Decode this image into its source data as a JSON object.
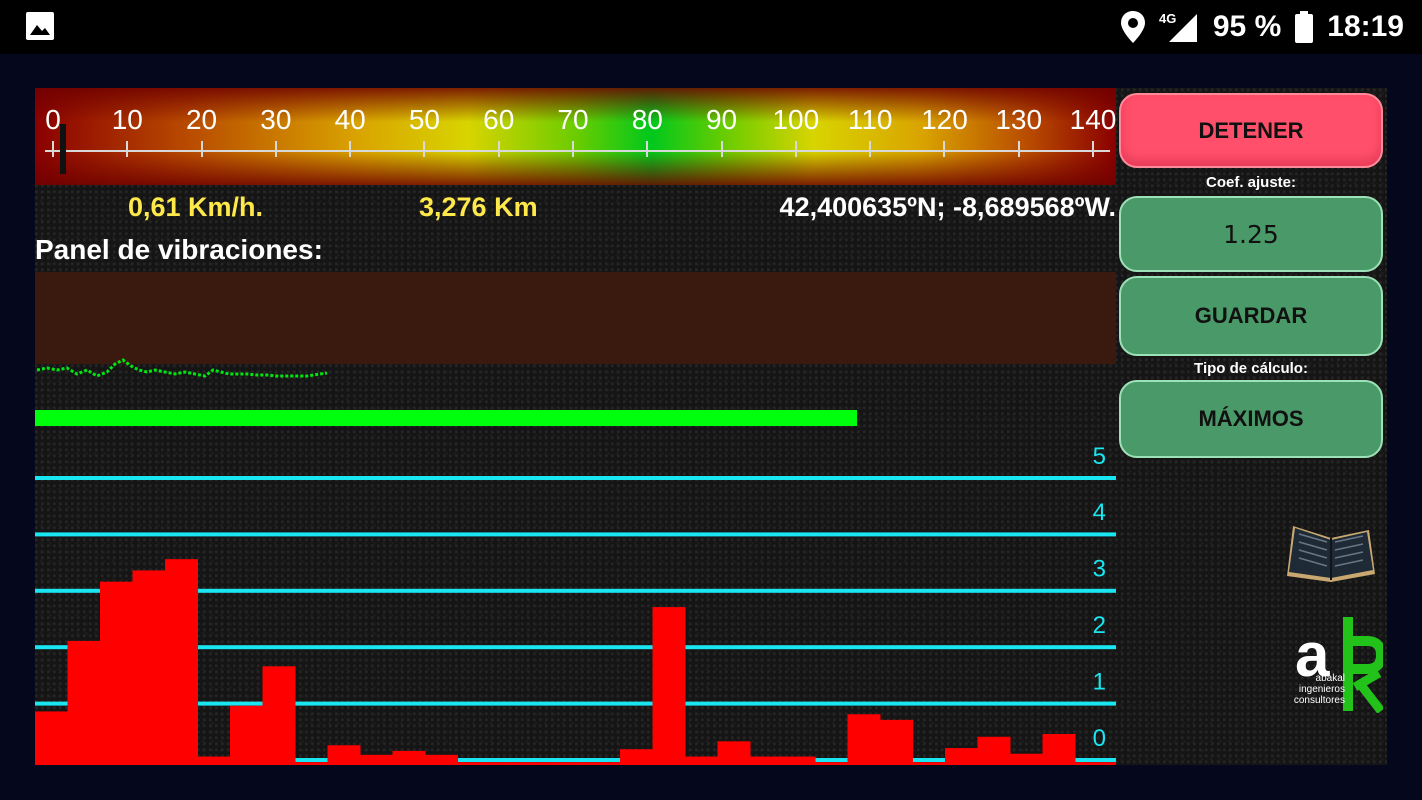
{
  "status_bar": {
    "network": "4G",
    "battery": "95 %",
    "time": "18:19"
  },
  "speed_scale": {
    "labels": [
      "0",
      "10",
      "20",
      "30",
      "40",
      "50",
      "60",
      "70",
      "80",
      "90",
      "100",
      "110",
      "120",
      "130",
      "140"
    ],
    "min": 0,
    "max": 140,
    "needle_value": 0.61
  },
  "readouts": {
    "speed": "0,61 Km/h.",
    "distance": "3,276 Km",
    "coords": "42,400635ºN; -8,689568ºW."
  },
  "panel": {
    "title": "Panel de vibraciones:"
  },
  "vibration_level": 0.76,
  "controls": {
    "stop_label": "DETENER",
    "coef_label": "Coef. ajuste:",
    "coef_value": "1.25",
    "save_label": "GUARDAR",
    "calc_label": "Tipo de cálculo:",
    "calc_value": "MÁXIMOS"
  },
  "logo": {
    "sub_lines": [
      "abakal",
      "ingenieros",
      "consultores"
    ]
  },
  "colors": {
    "stop_button": "#ff4f6b",
    "green_button": "#4a9a69",
    "grid_line": "#19e6f0",
    "bar": "#ff0000",
    "vibration_bar": "#00ff0c"
  },
  "chart_data": {
    "type": "bar",
    "ylim": [
      0,
      5
    ],
    "y_ticks": [
      "0",
      "1",
      "2",
      "3",
      "4",
      "5"
    ],
    "values": [
      0.95,
      2.2,
      3.25,
      3.45,
      3.65,
      0.15,
      1.05,
      1.75,
      0.05,
      0.35,
      0.18,
      0.25,
      0.18,
      0.05,
      0.05,
      0.05,
      0.05,
      0.05,
      0.28,
      2.8,
      0.15,
      0.42,
      0.15,
      0.15,
      0.05,
      0.9,
      0.8,
      0.05,
      0.3,
      0.5,
      0.2,
      0.55,
      0.05,
      0.05
    ]
  }
}
